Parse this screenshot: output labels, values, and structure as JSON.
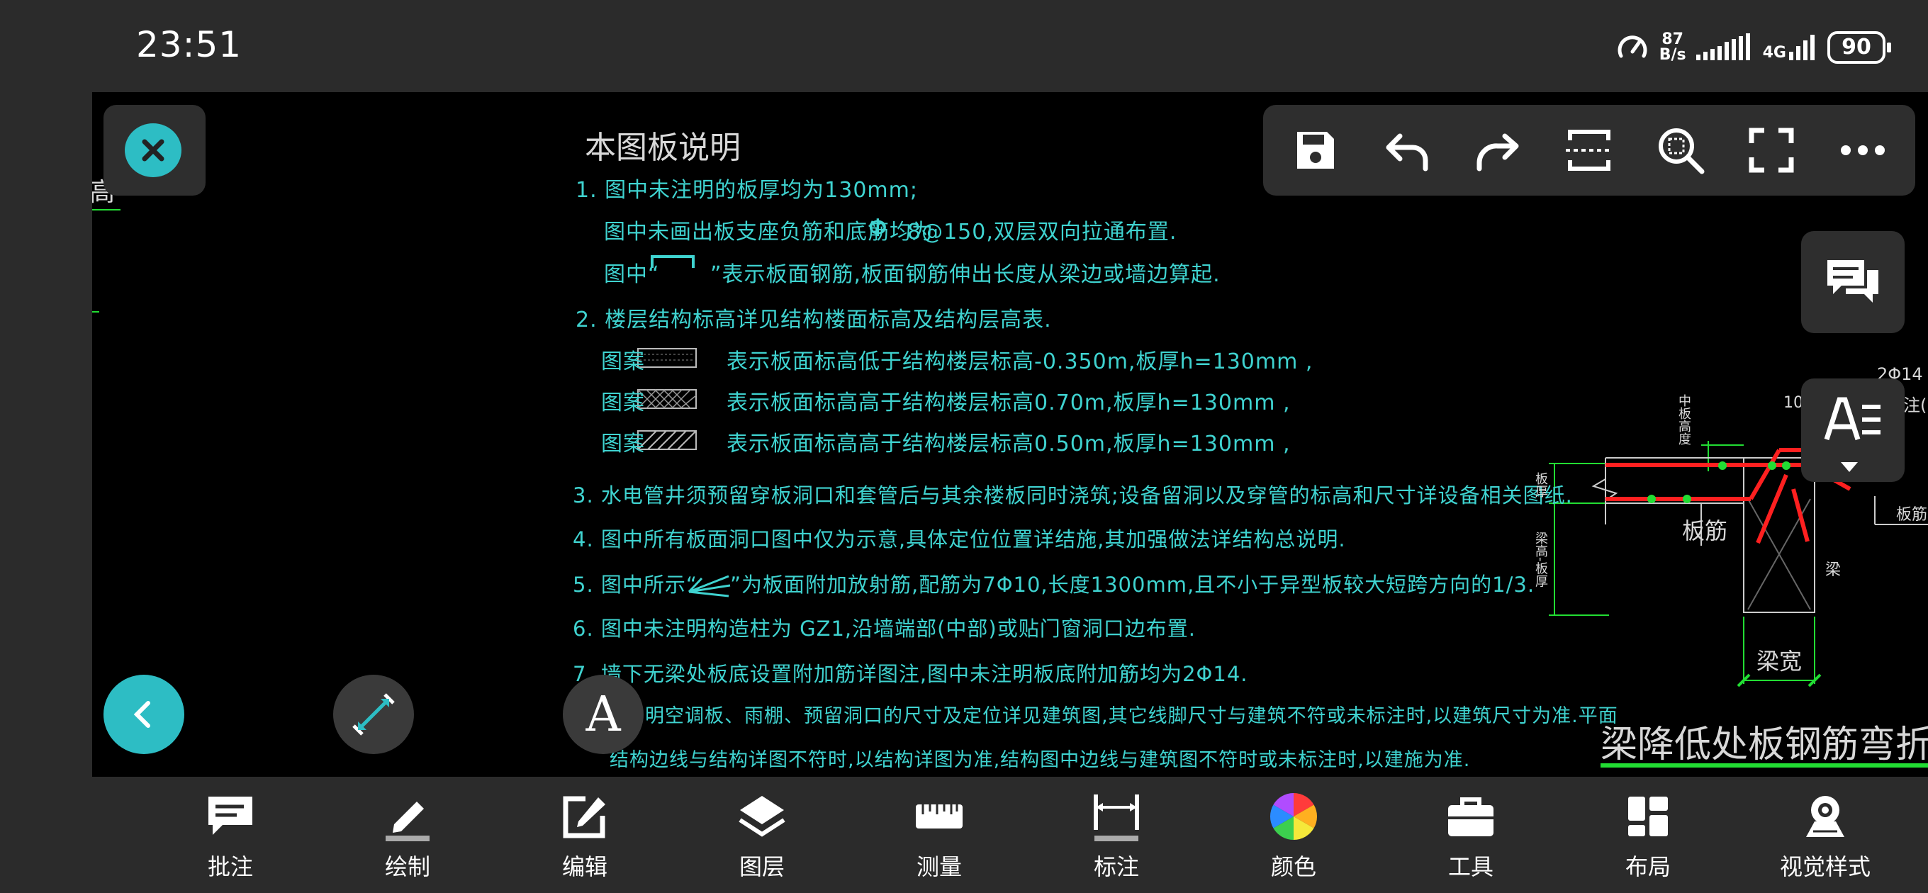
{
  "status_bar": {
    "time": "23:51",
    "net_speed_value": "87",
    "net_speed_unit": "B/s",
    "network": "4G",
    "battery": "90"
  },
  "drawing": {
    "title": "本图板说明",
    "left_edge_label": "高",
    "notes": [
      "1.  图中未注明的板厚均为130mm;",
      "图中未画出板支座负筋和底筋均为",
      "8@150,双层双向拉通布置.",
      "图中“",
      "”表示板面钢筋,板面钢筋伸出长度从梁边或墙边算起.",
      "2.  楼层结构标高详见结构楼面标高及结构层高表.",
      "图案",
      "表示板面标高低于结构楼层标高-0.350m,板厚h=130mm ,",
      "图案",
      "表示板面标高高于结构楼层标高0.70m,板厚h=130mm ,",
      "图案",
      "表示板面标高高于结构楼层标高0.50m,板厚h=130mm ,",
      "3.  水电管井须预留穿板洞口和套管后与其余楼板同时浇筑;设备留洞以及穿管的标高和尺寸详设备相关图纸.",
      "4.  图中所有板面洞口图中仅为示意,具体定位位置详结施,其加强做法详结构总说明.",
      "5.  图中所示“",
      "”为板面附加放射筋,配筋为7Φ10,长度1300mm,且不小于异型板较大短跨方向的1/3.",
      "6.  图中未注明构造柱为 GZ1,沿墙端部(中部)或贴门窗洞口边布置.",
      "7.  墙下无梁处板底设置附加筋详图注,图中未注明板底附加筋均为2Φ14.",
      "明空调板、雨棚、预留洞口的尺寸及定位详见建筑图,其它线脚尺寸与建筑不符或未标注时,以建筑尺寸为准.平面",
      "结构边线与结构详图不符时,以结构详图为准,结构图中边线与建筑图不符时或未标注时,以建施为准."
    ],
    "phi_symbol": "Φ",
    "detail": {
      "top_label": "2Φ14",
      "num_label": "10",
      "side_label": "注(",
      "vert_label_1": "中板高度",
      "vert_label_2": "板厚",
      "vert_label_3": "梁高-板厚",
      "slab_label": "板筋",
      "right_slab_label": "板筋",
      "beam_label": "梁",
      "beam_width_label": "梁宽",
      "caption": "梁降低处板钢筋弯折大样"
    }
  },
  "toolbar": {
    "save": "save-icon",
    "undo": "undo-icon",
    "redo": "redo-icon",
    "section": "section-icon",
    "zoom_window": "zoom-window-icon",
    "fullscreen": "fullscreen-icon",
    "more": "more-icon"
  },
  "bottom_nav": [
    {
      "label": "批注",
      "icon": "annotation-icon"
    },
    {
      "label": "绘制",
      "icon": "pencil-icon"
    },
    {
      "label": "编辑",
      "icon": "edit-icon"
    },
    {
      "label": "图层",
      "icon": "layers-icon"
    },
    {
      "label": "测量",
      "icon": "ruler-icon"
    },
    {
      "label": "标注",
      "icon": "dimension-icon"
    },
    {
      "label": "颜色",
      "icon": "color-wheel-icon"
    },
    {
      "label": "工具",
      "icon": "toolbox-icon"
    },
    {
      "label": "布局",
      "icon": "layout-icon"
    },
    {
      "label": "视觉样式",
      "icon": "visual-style-icon"
    }
  ],
  "floating": {
    "text_tool_label": "A"
  },
  "colors": {
    "accent": "#2dbdc4",
    "drawing_text": "#3fd3d0",
    "drawing_bg": "#000000",
    "rebar_red": "#ff2020",
    "dim_green": "#22dd33"
  }
}
